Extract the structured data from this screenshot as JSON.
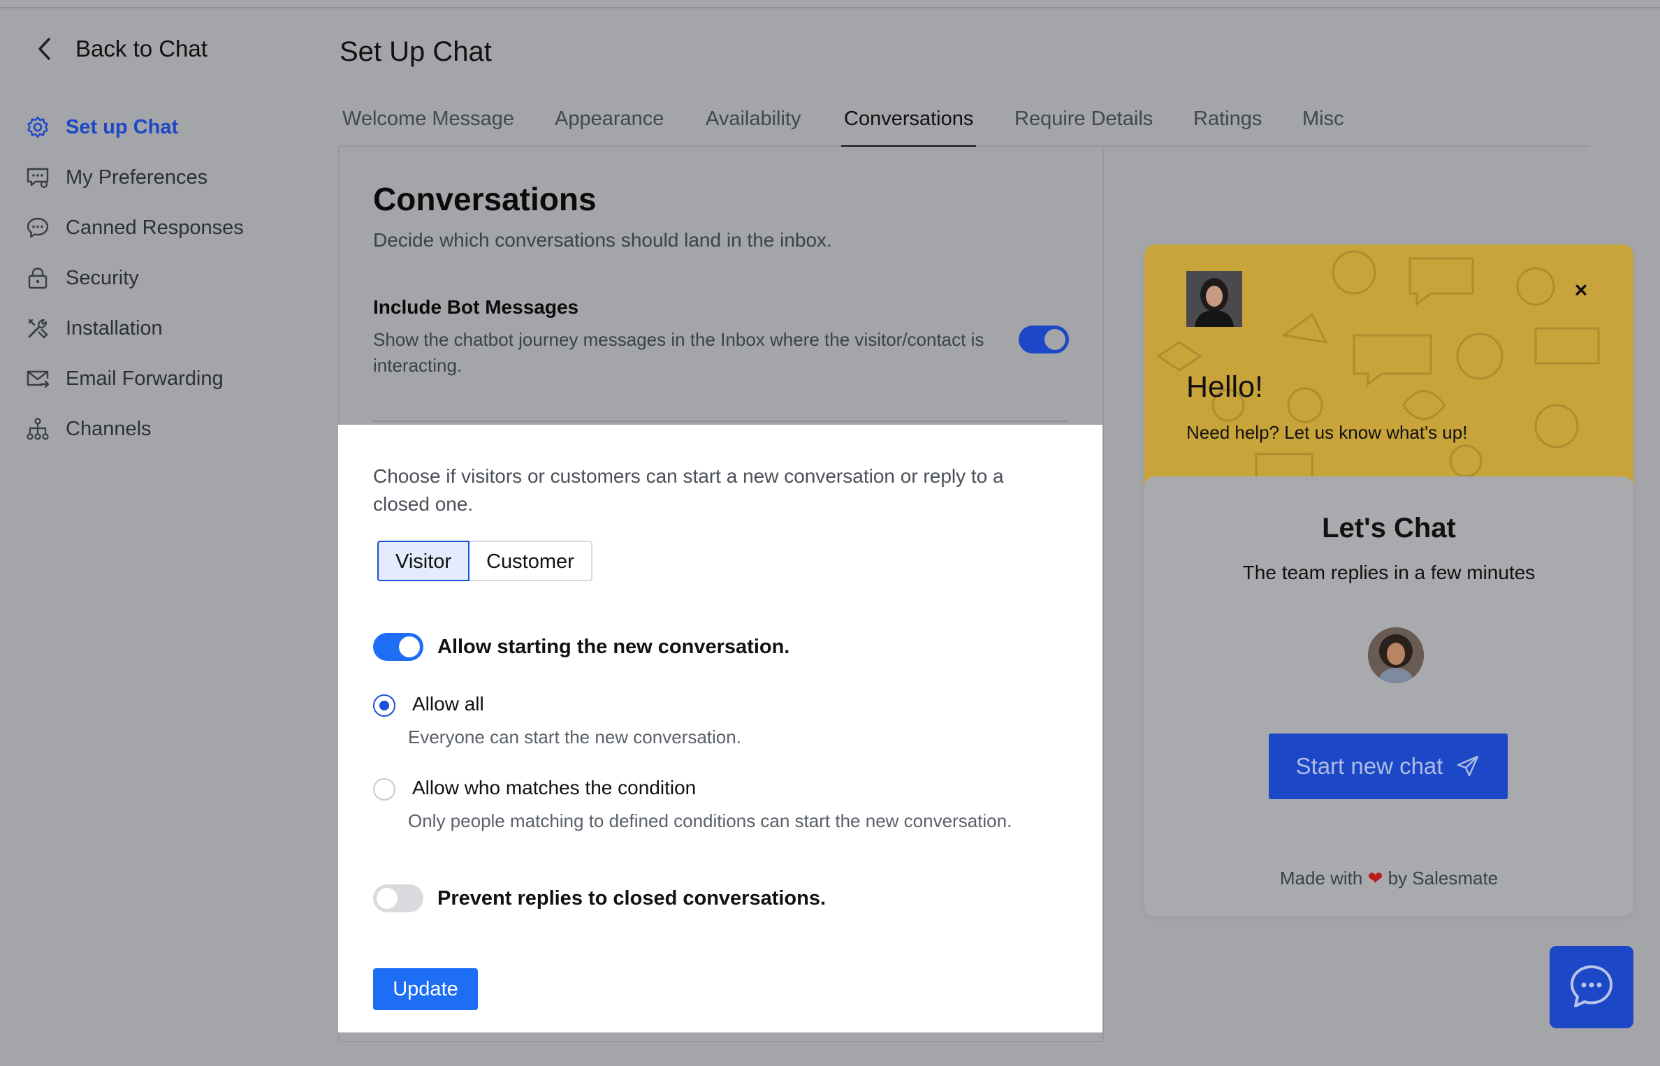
{
  "sidebar": {
    "back_label": "Back to Chat",
    "items": [
      {
        "label": "Set up Chat",
        "icon": "gear-icon",
        "active": true
      },
      {
        "label": "My Preferences",
        "icon": "chat-preferences-icon",
        "active": false
      },
      {
        "label": "Canned Responses",
        "icon": "speech-bubble-icon",
        "active": false
      },
      {
        "label": "Security",
        "icon": "lock-icon",
        "active": false
      },
      {
        "label": "Installation",
        "icon": "tools-icon",
        "active": false
      },
      {
        "label": "Email Forwarding",
        "icon": "email-forward-icon",
        "active": false
      },
      {
        "label": "Channels",
        "icon": "network-icon",
        "active": false
      }
    ]
  },
  "header": {
    "title": "Set Up Chat",
    "tabs": [
      {
        "label": "Welcome Message"
      },
      {
        "label": "Appearance"
      },
      {
        "label": "Availability"
      },
      {
        "label": "Conversations",
        "active": true
      },
      {
        "label": "Require Details"
      },
      {
        "label": "Ratings"
      },
      {
        "label": "Misc"
      }
    ]
  },
  "conversations": {
    "title": "Conversations",
    "subtitle": "Decide which conversations should land in the inbox.",
    "bot": {
      "title": "Include Bot Messages",
      "description": "Show the chatbot journey messages in the Inbox where the visitor/contact is interacting.",
      "enabled": true
    },
    "choose_text": "Choose if visitors or customers can start a new conversation or reply to a closed one.",
    "segments": {
      "visitor": "Visitor",
      "customer": "Customer",
      "selected": "Visitor"
    },
    "allow_start": {
      "label": "Allow starting the new conversation.",
      "enabled": true
    },
    "options": [
      {
        "label": "Allow all",
        "description": "Everyone can start the new conversation.",
        "selected": true
      },
      {
        "label": "Allow who matches the condition",
        "description": "Only people matching to defined conditions can start the new conversation.",
        "selected": false
      }
    ],
    "prevent_replies": {
      "label": "Prevent replies to closed conversations.",
      "enabled": false
    },
    "update_label": "Update"
  },
  "widget": {
    "hello": "Hello!",
    "help": "Need help? Let us know what's up!",
    "close": "×",
    "lets_chat": "Let's Chat",
    "team_replies": "The team replies in a few minutes",
    "start_label": "Start new chat",
    "made_with": "Made with",
    "by": "by Salesmate",
    "colors": {
      "banner": "#c8a43a",
      "button": "#1c47c6",
      "heart": "#b91c1c"
    }
  },
  "colors": {
    "accent": "#1d6ef5",
    "active_nav": "#1c47c6"
  }
}
